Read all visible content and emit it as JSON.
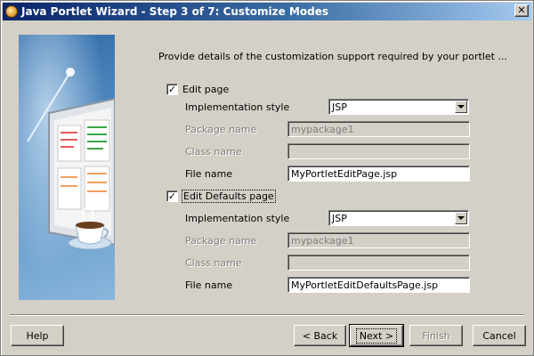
{
  "window": {
    "title": "Java Portlet Wizard - Step 3 of 7: Customize Modes",
    "close_glyph": "✕"
  },
  "intro_text": "Provide details of the customization support required by your portlet ...",
  "edit_page": {
    "checkbox_label": "Edit page",
    "checked": true,
    "check_glyph": "✓",
    "impl_style_label": "Implementation style",
    "impl_style_value": "JSP",
    "package_label": "Package name",
    "package_value": "mypackage1",
    "class_label": "Class name",
    "class_value": "",
    "file_label": "File name",
    "file_value": "MyPortletEditPage.jsp"
  },
  "edit_defaults_page": {
    "checkbox_label": "Edit Defaults page",
    "checked": true,
    "check_glyph": "✓",
    "impl_style_label": "Implementation style",
    "impl_style_value": "JSP",
    "package_label": "Package name",
    "package_value": "mypackage1",
    "class_label": "Class name",
    "class_value": "",
    "file_label": "File name",
    "file_value": "MyPortletEditDefaultsPage.jsp"
  },
  "buttons": {
    "help": "Help",
    "back": "< Back",
    "next": "Next >",
    "finish": "Finish",
    "cancel": "Cancel"
  },
  "colors": {
    "title_gradient_start": "#0a246a",
    "title_gradient_end": "#a6caf0",
    "dialog_bg": "#d4d0c8"
  }
}
